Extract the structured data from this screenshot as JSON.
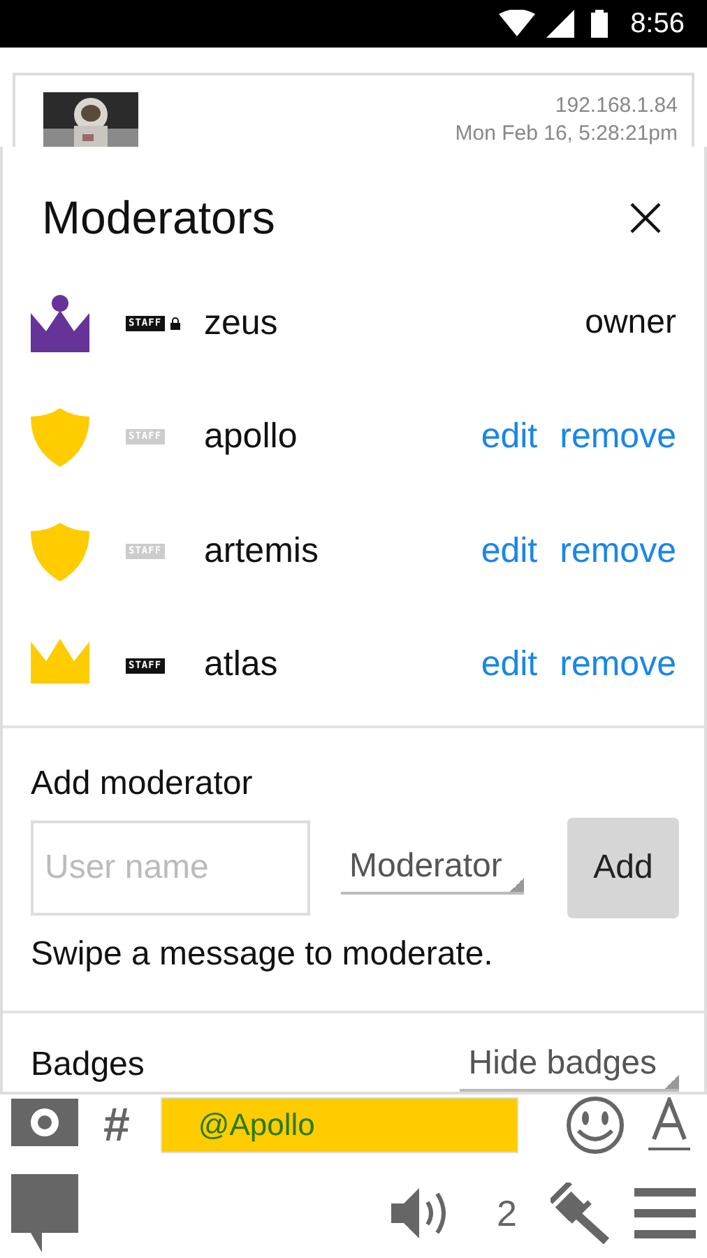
{
  "status_bar": {
    "time": "8:56"
  },
  "message": {
    "kind": "picture",
    "ip": "192.168.1.84",
    "timestamp": "Mon Feb 16, 5:28:21pm"
  },
  "dialog": {
    "title": "Moderators"
  },
  "moderators": [
    {
      "name": "zeus",
      "kind": "crown_dot",
      "color": "#663399",
      "badge": "STAFF",
      "badge_active": true,
      "locked": true,
      "role": "owner"
    },
    {
      "name": "apollo",
      "kind": "shield",
      "color": "#ffcc00",
      "badge": "STAFF",
      "badge_active": false,
      "locked": false,
      "actions": [
        "edit",
        "remove"
      ]
    },
    {
      "name": "artemis",
      "kind": "shield",
      "color": "#ffcc00",
      "badge": "STAFF",
      "badge_active": false,
      "locked": false,
      "actions": [
        "edit",
        "remove"
      ]
    },
    {
      "name": "atlas",
      "kind": "crown",
      "color": "#ffcc00",
      "badge": "STAFF",
      "badge_active": true,
      "locked": false,
      "actions": [
        "edit",
        "remove"
      ]
    }
  ],
  "add_moderator": {
    "label": "Add moderator",
    "placeholder": "User name",
    "role": "Moderator",
    "button": "Add",
    "hint": "Swipe a message to moderate."
  },
  "badges": {
    "label": "Badges",
    "value": "Hide badges"
  },
  "composer": {
    "hash": "#",
    "value": "@Apollo"
  },
  "toolbar": {
    "count": "2"
  }
}
